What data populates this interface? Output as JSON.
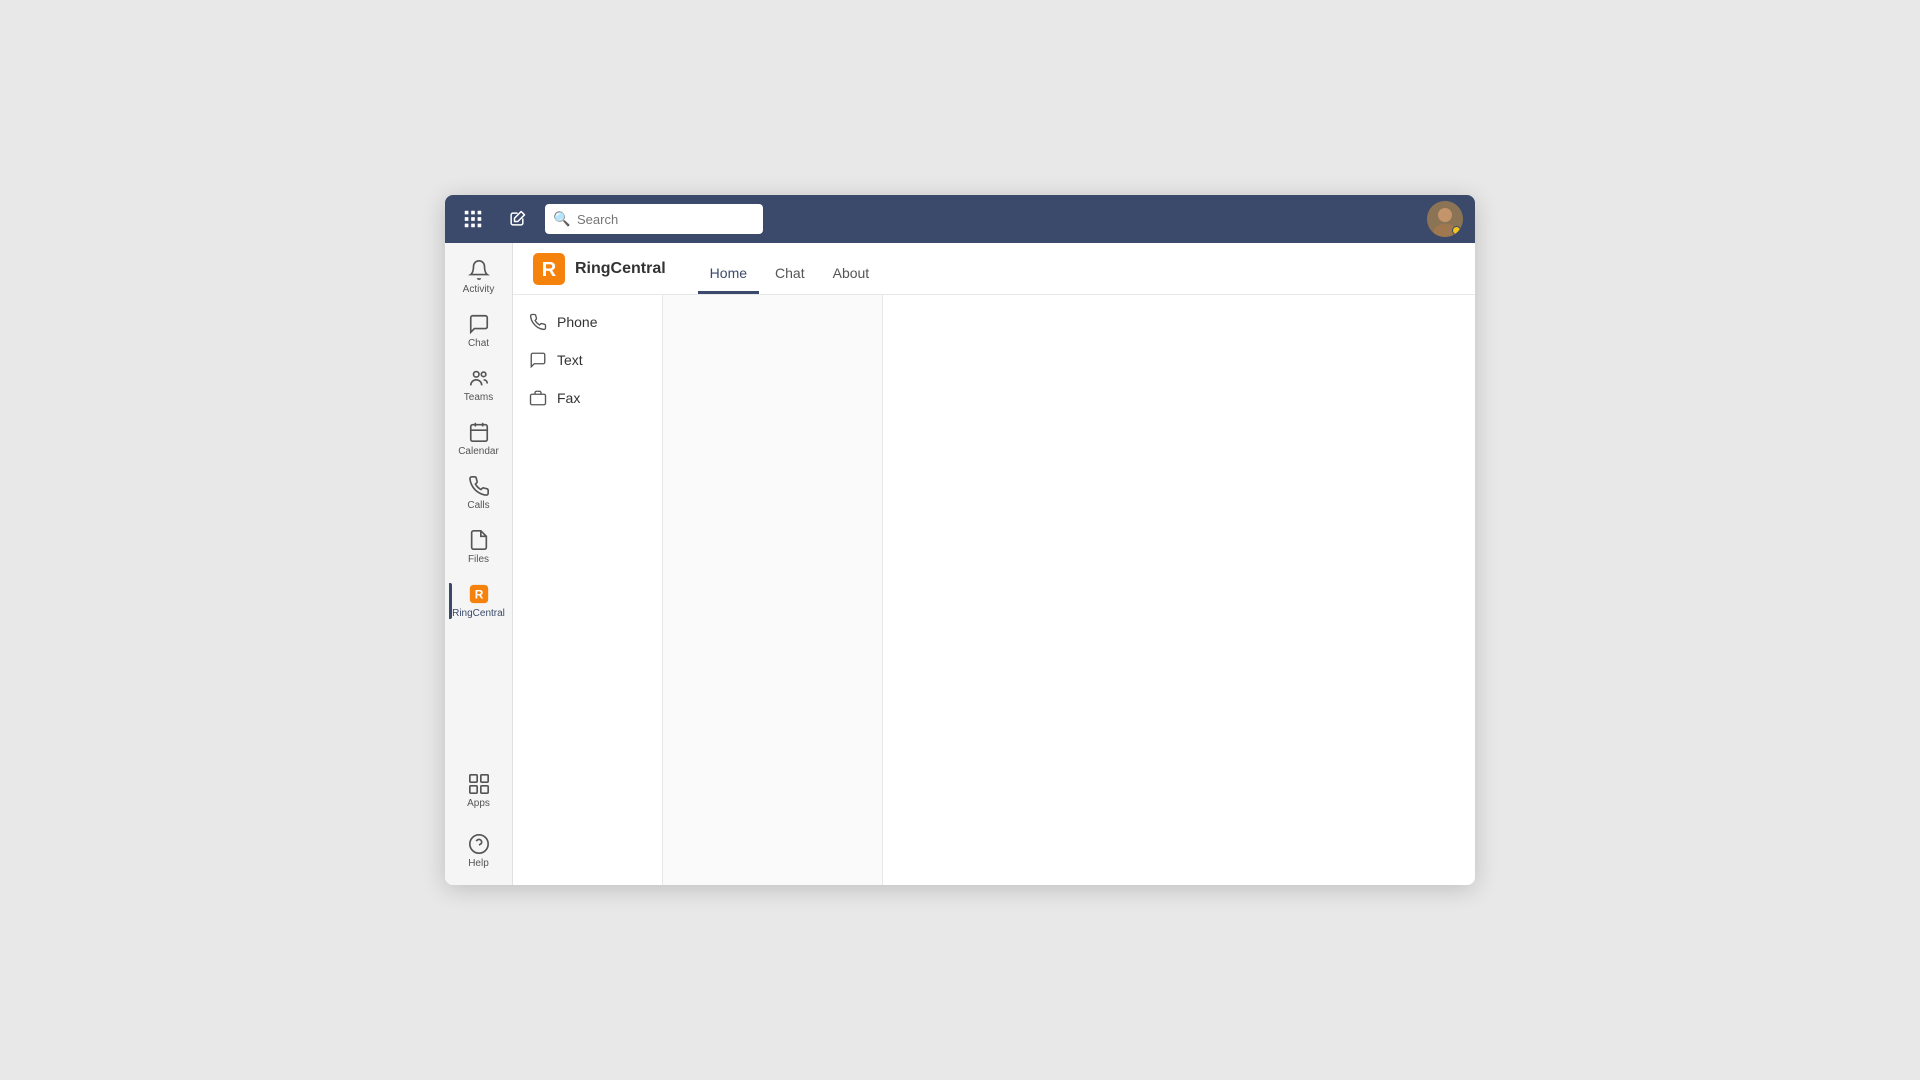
{
  "topbar": {
    "grid_icon": "grid-icon",
    "compose_icon": "compose-icon",
    "search_placeholder": "Search",
    "avatar_alt": "User avatar"
  },
  "sidebar": {
    "items": [
      {
        "id": "activity",
        "label": "Activity",
        "icon": "bell-icon"
      },
      {
        "id": "chat",
        "label": "Chat",
        "icon": "chat-icon"
      },
      {
        "id": "teams",
        "label": "Teams",
        "icon": "teams-icon"
      },
      {
        "id": "calendar",
        "label": "Calendar",
        "icon": "calendar-icon"
      },
      {
        "id": "calls",
        "label": "Calls",
        "icon": "calls-icon"
      },
      {
        "id": "files",
        "label": "Files",
        "icon": "files-icon"
      },
      {
        "id": "ringcentral",
        "label": "RingCentral",
        "icon": "ringcentral-icon",
        "active": true
      }
    ],
    "bottom_items": [
      {
        "id": "apps",
        "label": "Apps",
        "icon": "apps-icon"
      },
      {
        "id": "help",
        "label": "Help",
        "icon": "help-icon"
      }
    ]
  },
  "content_header": {
    "brand_name": "RingCentral",
    "tabs": [
      {
        "id": "home",
        "label": "Home",
        "active": true
      },
      {
        "id": "chat",
        "label": "Chat",
        "active": false
      },
      {
        "id": "about",
        "label": "About",
        "active": false
      }
    ]
  },
  "subpanel": {
    "items": [
      {
        "id": "phone",
        "label": "Phone",
        "icon": "phone-icon"
      },
      {
        "id": "text",
        "label": "Text",
        "icon": "text-icon"
      },
      {
        "id": "fax",
        "label": "Fax",
        "icon": "fax-icon"
      }
    ]
  }
}
